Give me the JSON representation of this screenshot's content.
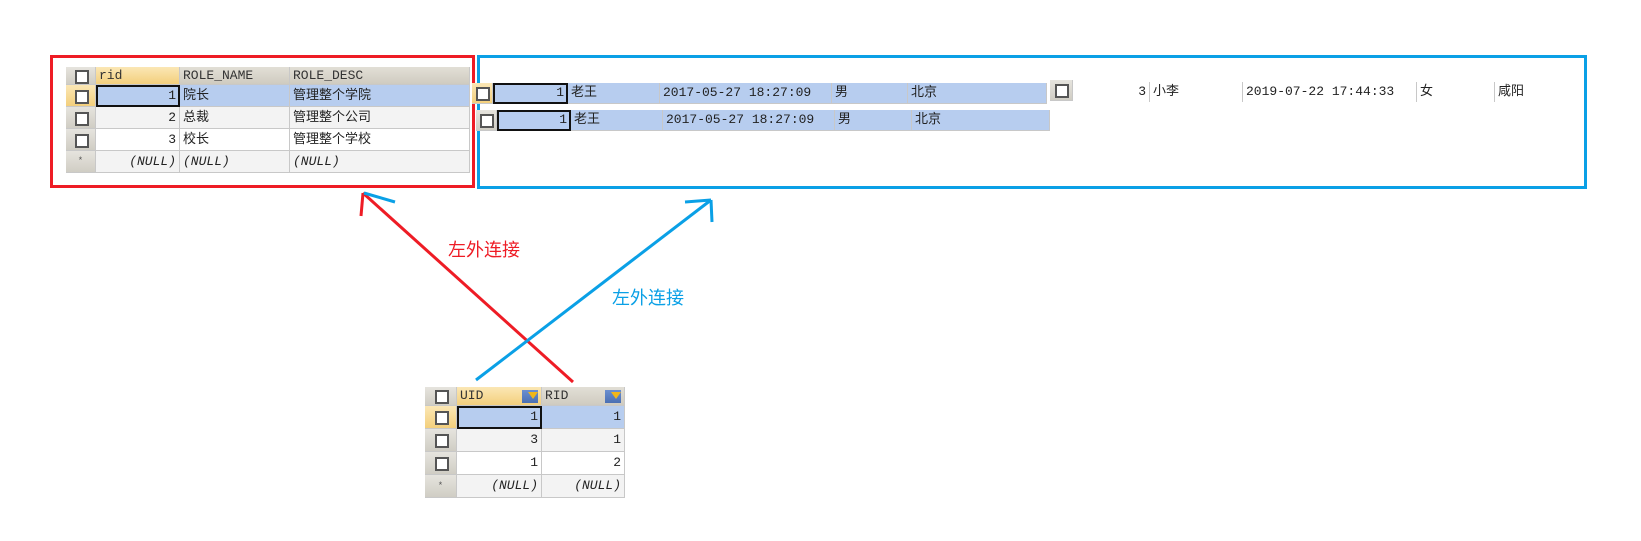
{
  "roles_table": {
    "columns": [
      "rid",
      "ROLE_NAME",
      "ROLE_DESC"
    ],
    "rows": [
      [
        "1",
        "院长",
        "管理整个学院"
      ],
      [
        "2",
        "总裁",
        "管理整个公司"
      ],
      [
        "3",
        "校长",
        "管理整个学校"
      ]
    ],
    "null_row": [
      "(NULL)",
      "(NULL)",
      "(NULL)"
    ]
  },
  "users_result": {
    "row1": [
      "1",
      "老王",
      "2017-05-27 18:27:09",
      "男",
      "北京"
    ],
    "row1_extra": [
      "3",
      "小李",
      "2019-07-22 17:44:33",
      "女",
      "咸阳"
    ],
    "row2": [
      "1",
      "老王",
      "2017-05-27 18:27:09",
      "男",
      "北京"
    ]
  },
  "user_role_table": {
    "columns": [
      "UID",
      "RID"
    ],
    "rows": [
      [
        "1",
        "1"
      ],
      [
        "3",
        "1"
      ],
      [
        "1",
        "2"
      ]
    ],
    "null_row": [
      "(NULL)",
      "(NULL)"
    ]
  },
  "annotations": {
    "red_label": "左外连接",
    "blue_label": "左外连接",
    "red_color": "#ee1c25",
    "blue_color": "#0aa0e6"
  }
}
